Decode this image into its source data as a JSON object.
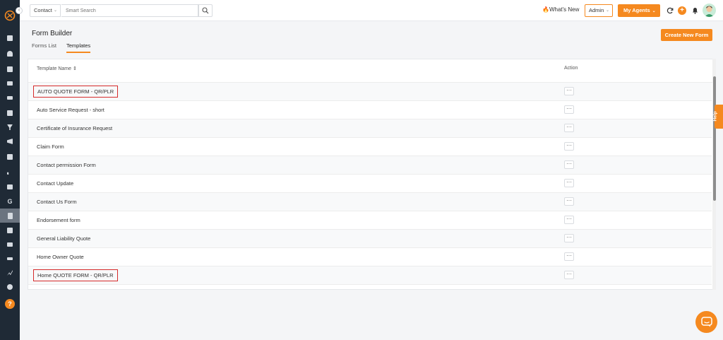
{
  "topbar": {
    "search_scope": "Contact",
    "search_placeholder": "Smart Search",
    "whats_new": "What's New",
    "role": "Admin",
    "agents_button": "My Agents"
  },
  "page": {
    "title": "Form Builder",
    "tabs": [
      {
        "label": "Forms List",
        "active": false
      },
      {
        "label": "Templates",
        "active": true
      }
    ],
    "create_button": "Create New Form"
  },
  "table": {
    "columns": {
      "name": "Template Name ⇕",
      "action": "Action"
    },
    "action_label": "···",
    "rows": [
      {
        "name": "AUTO QUOTE FORM - QR/PLR",
        "highlighted": true
      },
      {
        "name": "Auto Service Request - short",
        "highlighted": false
      },
      {
        "name": "Certificate of Insurance Request",
        "highlighted": false
      },
      {
        "name": "Claim Form",
        "highlighted": false
      },
      {
        "name": "Contact permission Form",
        "highlighted": false
      },
      {
        "name": "Contact Update",
        "highlighted": false
      },
      {
        "name": "Contact Us Form",
        "highlighted": false
      },
      {
        "name": "Endorsement form",
        "highlighted": false
      },
      {
        "name": "General Liability Quote",
        "highlighted": false
      },
      {
        "name": "Home Owner Quote",
        "highlighted": false
      },
      {
        "name": "Home QUOTE FORM - QR/PLR",
        "highlighted": true
      }
    ]
  },
  "help_tab": "Help",
  "sidebar_help": "?",
  "colors": {
    "accent": "#f5891f",
    "sidebar": "#1f2a36",
    "highlight_border": "#d62b2b"
  }
}
